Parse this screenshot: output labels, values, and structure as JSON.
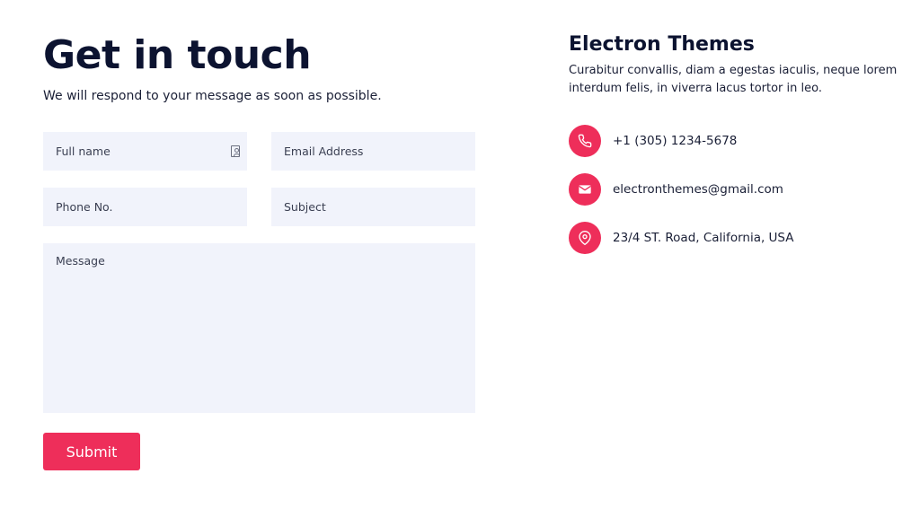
{
  "header": {
    "title": "Get in touch",
    "subtitle": "We will respond to your message as soon as possible."
  },
  "form": {
    "full_name_placeholder": "Full name",
    "email_placeholder": "Email Address",
    "phone_placeholder": "Phone No.",
    "subject_placeholder": "Subject",
    "message_placeholder": "Message",
    "submit_label": "Submit"
  },
  "info": {
    "company": "Electron Themes",
    "description": "Curabitur convallis, diam a egestas iaculis, neque lorem interdum felis, in viverra lacus tortor in leo.",
    "items": [
      {
        "icon": "phone-icon",
        "text": "+1 (305) 1234-5678"
      },
      {
        "icon": "envelope-icon",
        "text": "electronthemes@gmail.com"
      },
      {
        "icon": "location-pin-icon",
        "text": "23/4 ST. Road, California, USA"
      }
    ]
  },
  "colors": {
    "accent": "#ee2e5a",
    "field_background": "#f1f3fb",
    "heading": "#0c1330"
  }
}
